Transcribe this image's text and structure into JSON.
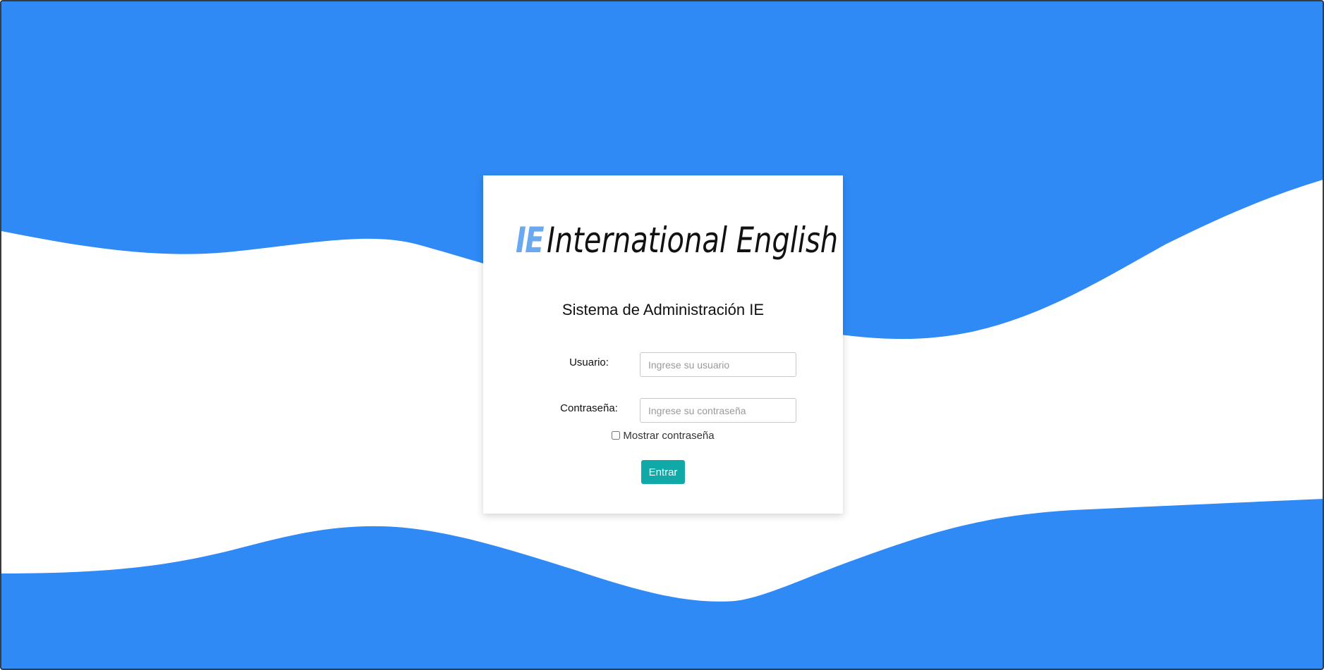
{
  "colors": {
    "background": "#2f8af5",
    "wave": "#ffffff",
    "logo_accent": "#6aa8f0",
    "button": "#11a8a8"
  },
  "logo": {
    "mark": "IE",
    "name": "International English"
  },
  "system_title": "Sistema de Administración IE",
  "form": {
    "username_label": "Usuario:",
    "username_placeholder": "Ingrese su usuario",
    "password_label": "Contraseña:",
    "password_placeholder": "Ingrese su contraseña",
    "show_password_label": "Mostrar contraseña",
    "submit_label": "Entrar"
  }
}
